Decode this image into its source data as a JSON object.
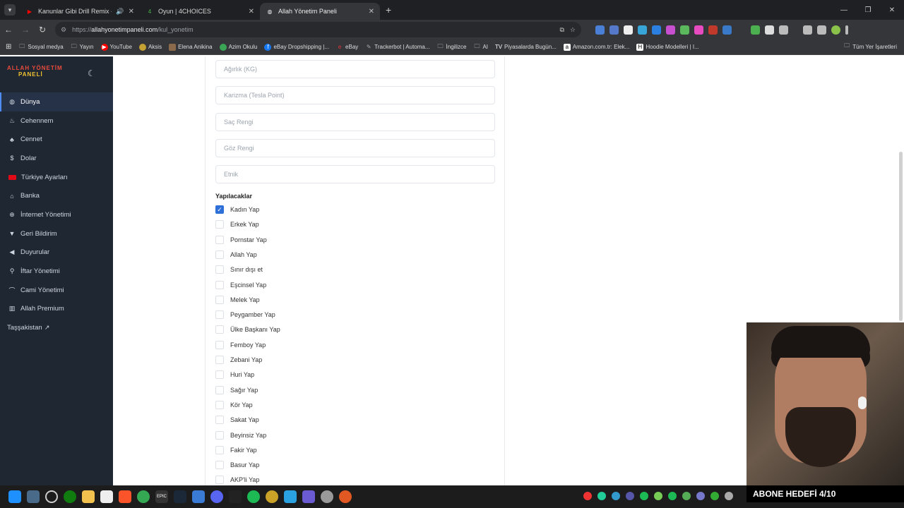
{
  "browser": {
    "tabs": [
      {
        "title": "Kanunlar Gibi Drill Remix - ",
        "favicon": "youtube-icon",
        "color": "#ff0000"
      },
      {
        "title": "Oyun | 4CHOICES",
        "favicon": "4choices-icon",
        "color": "#4caf50"
      },
      {
        "title": "Allah Yönetim Paneli",
        "favicon": "globe-icon",
        "color": "#aaaaaa"
      }
    ],
    "url_prefix": "https://",
    "url_host": "allahyonetimpaneli.com",
    "url_path": "/kul_yonetim",
    "bookmarks": [
      {
        "label": "Sosyal medya",
        "icon": "folder-icon"
      },
      {
        "label": "Yayın",
        "icon": "folder-icon"
      },
      {
        "label": "YouTube",
        "icon": "youtube-icon"
      },
      {
        "label": "Aksis",
        "icon": "aksis-icon"
      },
      {
        "label": "Elena Anikina",
        "icon": "image-icon"
      },
      {
        "label": "Azim Okulu",
        "icon": "azim-icon"
      },
      {
        "label": "eBay Dropshipping |...",
        "icon": "facebook-icon"
      },
      {
        "label": "eBay",
        "icon": "ebay-icon"
      },
      {
        "label": "Trackerbot | Automa...",
        "icon": "trackerbot-icon"
      },
      {
        "label": "İngilizce",
        "icon": "folder-icon"
      },
      {
        "label": "AI",
        "icon": "folder-icon"
      },
      {
        "label": "Piyasalarda Bugün...",
        "icon": "tradingview-icon"
      },
      {
        "label": "Amazon.com.tr: Elek...",
        "icon": "amazon-icon"
      },
      {
        "label": "Hoodie Modelleri | I...",
        "icon": "hoodie-icon"
      }
    ],
    "bookmarks_right": "Tüm Yer İşaretleri"
  },
  "sidebar": {
    "logo_line1": "ALLAH YÖNETİM",
    "logo_line2": "PANELİ",
    "items": [
      {
        "label": "Dünya",
        "icon": "globe-icon"
      },
      {
        "label": "Cehennem",
        "icon": "fire-icon"
      },
      {
        "label": "Cennet",
        "icon": "tree-icon"
      },
      {
        "label": "Dolar",
        "icon": "dollar-icon"
      },
      {
        "label": "Türkiye Ayarları",
        "icon": "turkey-flag-icon"
      },
      {
        "label": "Banka",
        "icon": "bank-icon"
      },
      {
        "label": "İnternet Yönetimi",
        "icon": "internet-icon"
      },
      {
        "label": "Geri Bildirim",
        "icon": "thumbs-down-icon"
      },
      {
        "label": "Duyurular",
        "icon": "megaphone-icon"
      },
      {
        "label": "İftar Yönetimi",
        "icon": "utensils-icon"
      },
      {
        "label": "Cami Yönetimi",
        "icon": "mosque-icon"
      },
      {
        "label": "Allah Premium",
        "icon": "chart-icon"
      }
    ],
    "external_link": "Taşşakistan"
  },
  "form": {
    "fields": [
      {
        "placeholder": "Ağırlık (KG)"
      },
      {
        "placeholder": "Karizma (Tesla Point)"
      },
      {
        "placeholder": "Saç Rengi"
      },
      {
        "placeholder": "Göz Rengi"
      },
      {
        "placeholder": "Etnik"
      }
    ],
    "section_title": "Yapılacaklar",
    "checkboxes": [
      {
        "label": "Kadın Yap",
        "checked": true
      },
      {
        "label": "Erkek Yap",
        "checked": false
      },
      {
        "label": "Pornstar Yap",
        "checked": false
      },
      {
        "label": "Allah Yap",
        "checked": false
      },
      {
        "label": "Sınır dışı et",
        "checked": false
      },
      {
        "label": "Eşcinsel Yap",
        "checked": false
      },
      {
        "label": "Melek Yap",
        "checked": false
      },
      {
        "label": "Peygamber Yap",
        "checked": false
      },
      {
        "label": "Ülke Başkanı Yap",
        "checked": false
      },
      {
        "label": "Femboy Yap",
        "checked": false
      },
      {
        "label": "Zebani Yap",
        "checked": false
      },
      {
        "label": "Huri Yap",
        "checked": false
      },
      {
        "label": "Sağır Yap",
        "checked": false
      },
      {
        "label": "Kör Yap",
        "checked": false
      },
      {
        "label": "Sakat Yap",
        "checked": false
      },
      {
        "label": "Beyinsiz Yap",
        "checked": false
      },
      {
        "label": "Fakir Yap",
        "checked": false
      },
      {
        "label": "Basur Yap",
        "checked": false
      },
      {
        "label": "AKP'li Yap",
        "checked": false
      }
    ]
  },
  "overlay": {
    "caption": "ABONE HEDEFİ 4/10"
  },
  "colors": {
    "sidebar_bg": "#1f2733",
    "accent": "#2f6fd8",
    "browser_bg": "#35363a"
  }
}
